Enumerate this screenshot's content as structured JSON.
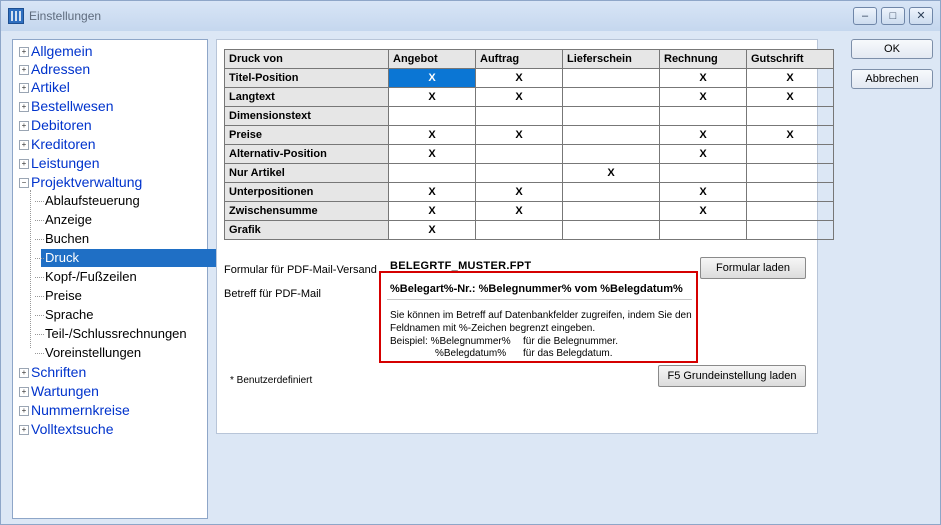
{
  "window": {
    "title": "Einstellungen"
  },
  "tree": {
    "roots_top": [
      "Allgemein",
      "Adressen",
      "Artikel",
      "Bestellwesen",
      "Debitoren",
      "Kreditoren",
      "Leistungen"
    ],
    "expanded": "Projektverwaltung",
    "children": [
      "Ablaufsteuerung",
      "Anzeige",
      "Buchen",
      "Druck",
      "Kopf-/Fußzeilen",
      "Preise",
      "Sprache",
      "Teil-/Schlussrechnungen",
      "Voreinstellungen"
    ],
    "selected": "Druck",
    "roots_bottom": [
      "Schriften",
      "Wartungen",
      "Nummernkreise",
      "Volltextsuche"
    ]
  },
  "table": {
    "header": [
      "Druck von",
      "Angebot",
      "Auftrag",
      "Lieferschein",
      "Rechnung",
      "Gutschrift"
    ],
    "rows": [
      [
        "Titel-Position",
        "X",
        "X",
        "",
        "X",
        "X"
      ],
      [
        "Langtext",
        "X",
        "X",
        "",
        "X",
        "X"
      ],
      [
        "Dimensionstext",
        "",
        "",
        "",
        "",
        ""
      ],
      [
        "Preise",
        "X",
        "X",
        "",
        "X",
        "X"
      ],
      [
        "Alternativ-Position",
        "X",
        "",
        "",
        "X",
        ""
      ],
      [
        "Nur Artikel",
        "",
        "",
        "X",
        "",
        ""
      ],
      [
        "Unterpositionen",
        "X",
        "X",
        "",
        "X",
        ""
      ],
      [
        "Zwischensumme",
        "X",
        "X",
        "",
        "X",
        ""
      ],
      [
        "Grafik",
        "X",
        "",
        "",
        "",
        ""
      ]
    ]
  },
  "form": {
    "pdf_label": "Formular für PDF-Mail-Versand",
    "pdf_value": "BELEGRTF_MUSTER.FPT",
    "load_form_button": "Formular laden",
    "subject_label": "Betreff für PDF-Mail",
    "subject_value": "%Belegart%-Nr.: %Belegnummer% vom %Belegdatum%",
    "hint_line1": "Sie können im Betreff auf Datenbankfelder zugreifen, indem Sie den",
    "hint_line2": "Feldnamen mit %-Zeichen begrenzt eingeben.",
    "hint_line3a": "Beispiel:  %Belegnummer%",
    "hint_line3b": "für die Belegnummer.",
    "hint_line4a": "%Belegdatum%",
    "hint_line4b": "für das Belegdatum.",
    "user_defined_note": "* Benutzerdefiniert",
    "default_button": "F5 Grundeinstellung laden"
  },
  "buttons": {
    "ok": "OK",
    "cancel": "Abbrechen"
  },
  "window_controls": {
    "min": "–",
    "max": "□",
    "close": "✕"
  }
}
